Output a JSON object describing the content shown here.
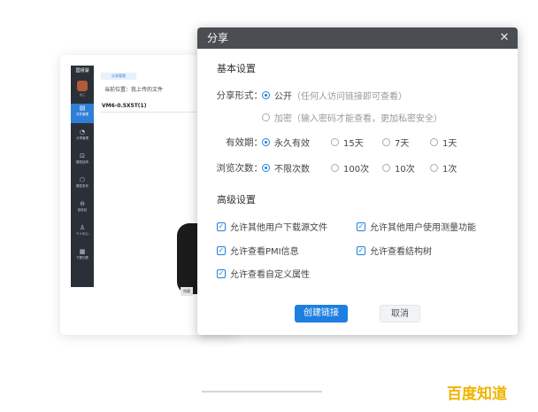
{
  "background_app": {
    "logo": "国钥湖",
    "avatar_name": "张三",
    "nav_items": [
      {
        "label": "文件管理",
        "icon": "file-icon"
      },
      {
        "label": "分享管理",
        "icon": "share-icon"
      },
      {
        "label": "模型结构",
        "icon": "structure-icon"
      },
      {
        "label": "模型发布",
        "icon": "publish-icon"
      },
      {
        "label": "回收站",
        "icon": "recycle-icon"
      },
      {
        "label": "个人中心",
        "icon": "user-icon"
      },
      {
        "label": "下载列表",
        "icon": "download-icon"
      }
    ],
    "tab_label": "分享管理",
    "path": "当前位置：我上传的文件",
    "model_name": "VM6-0.5X5T(1)",
    "model_tag": "隐藏"
  },
  "dialog": {
    "title": "分享",
    "close_icon": "close-icon",
    "basic_title": "基本设置",
    "share_form_label": "分享形式：",
    "share_options": [
      {
        "label": "公开",
        "hint": "（任何人访问链接即可查看）",
        "checked": true
      },
      {
        "label": "加密",
        "hint": "（输入密码才能查看，更加私密安全）",
        "checked": false
      }
    ],
    "validity_label": "有效期：",
    "validity_options": [
      "永久有效",
      "15天",
      "7天",
      "1天"
    ],
    "validity_selected": 0,
    "views_label": "浏览次数：",
    "views_options": [
      "不限次数",
      "100次",
      "10次",
      "1次"
    ],
    "views_selected": 0,
    "advanced_title": "高级设置",
    "advanced_options": [
      "允许其他用户下载源文件",
      "允许其他用户使用测量功能",
      "允许查看PMI信息",
      "允许查看结构树",
      "允许查看自定义属性"
    ],
    "create_button": "创建链接",
    "cancel_button": "取消"
  },
  "watermark": "百度知道",
  "colors": {
    "accent": "#1e7fe0",
    "header": "#4a4d52",
    "sidebar": "#2b3038",
    "watermark": "#f0b400"
  }
}
